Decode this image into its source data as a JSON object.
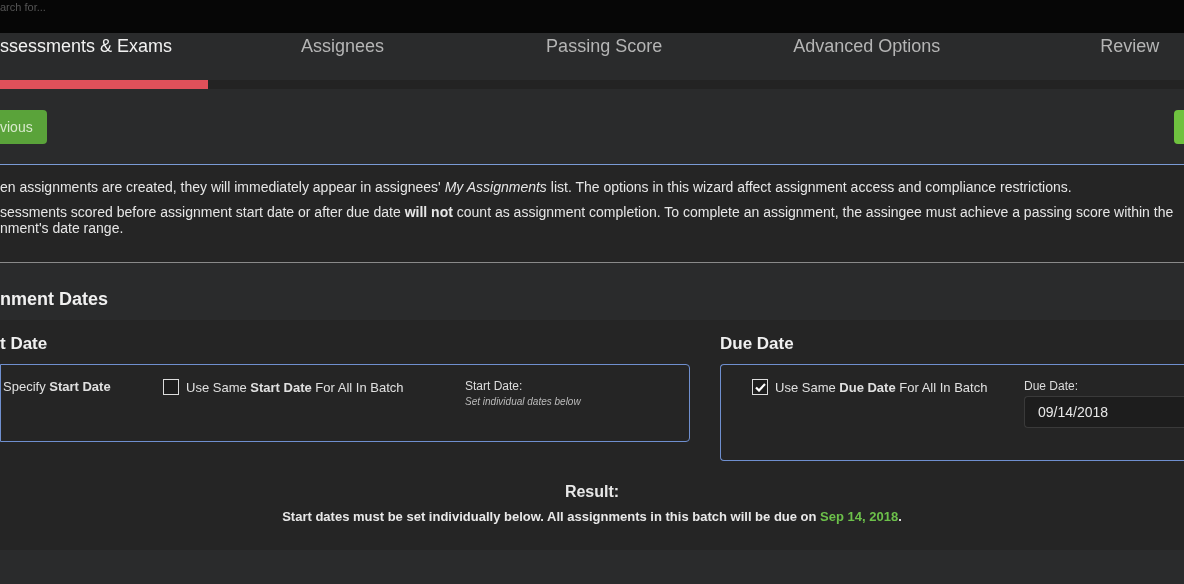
{
  "search": {
    "placeholder": "arch for..."
  },
  "tabs": [
    {
      "label": "ssessments & Exams",
      "selected": true
    },
    {
      "label": "Assignees",
      "selected": false
    },
    {
      "label": "Passing Score",
      "selected": false
    },
    {
      "label": "Advanced Options",
      "selected": false
    },
    {
      "label": "Review",
      "selected": false
    }
  ],
  "progress": {
    "level": 0.176
  },
  "nav": {
    "previous": "vious"
  },
  "info": [
    "en assignments are created, they will immediately appear in assignees' *My Assignments* list. The options in this wizard affect assignment access and compliance restrictions.",
    "sessments scored before assignment start date or after due date **will not** count as assignment completion. To complete an assignment, the assingee must achieve a passing score within the nment's date range."
  ],
  "section_title": "nment Dates",
  "start_date": {
    "title": "t Date",
    "specify": "Specify **Start Date**",
    "same": {
      "label": "Use Same **Start Date** For All In Batch",
      "checked": false
    },
    "field_label": "Start Date:",
    "note": "Set individual dates below"
  },
  "due_date": {
    "title": "Due Date",
    "same": {
      "label": "Use Same **Due Date** For All In Batch",
      "checked": true
    },
    "field_label": "Due Date:",
    "value": "09/14/2018"
  },
  "result": {
    "title": "Result:",
    "text": "Start dates must be set individually below. All assignments in this batch will be due on ",
    "date": "Sep 14, 2018",
    "end": "."
  }
}
